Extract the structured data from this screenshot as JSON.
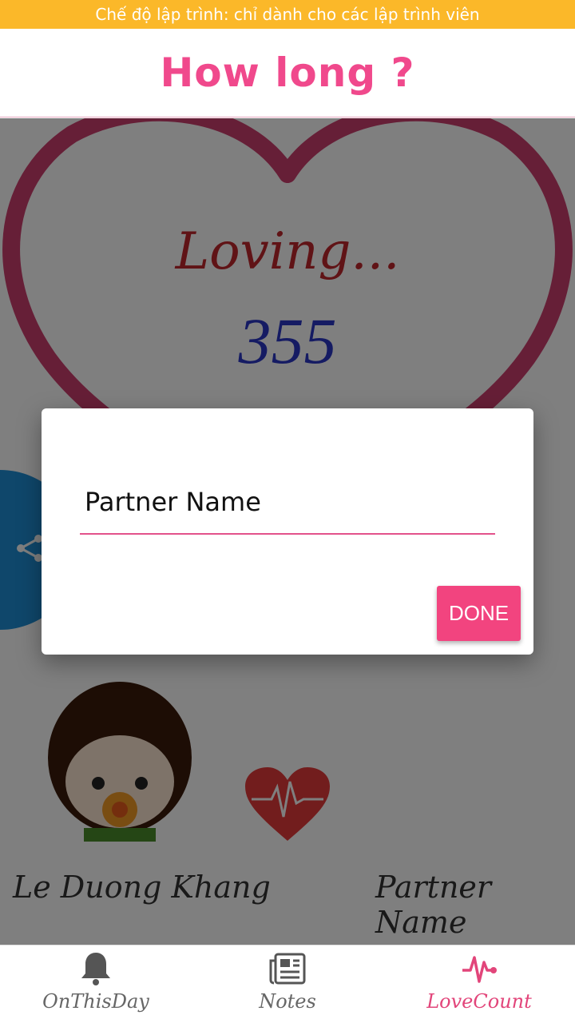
{
  "status_banner": "Chế độ lập trình: chỉ dành cho các lập trình viên",
  "header": {
    "title": "How long ?"
  },
  "main": {
    "loving_label": "Loving...",
    "day_count": "355",
    "person_left_name": "Le Duong Khang",
    "person_right_name": "Partner Name"
  },
  "dialog": {
    "input_value": "Partner Name",
    "done_label": "DONE"
  },
  "bottom_nav": {
    "items": [
      {
        "label": "OnThisDay",
        "icon": "bell-icon"
      },
      {
        "label": "Notes",
        "icon": "newspaper-icon"
      },
      {
        "label": "LoveCount",
        "icon": "heartbeat-icon",
        "active": true
      }
    ]
  },
  "colors": {
    "accent_pink": "#f0498c",
    "banner_yellow": "#fbb829",
    "count_blue": "#2b37c6",
    "loving_red": "#c0262c"
  }
}
